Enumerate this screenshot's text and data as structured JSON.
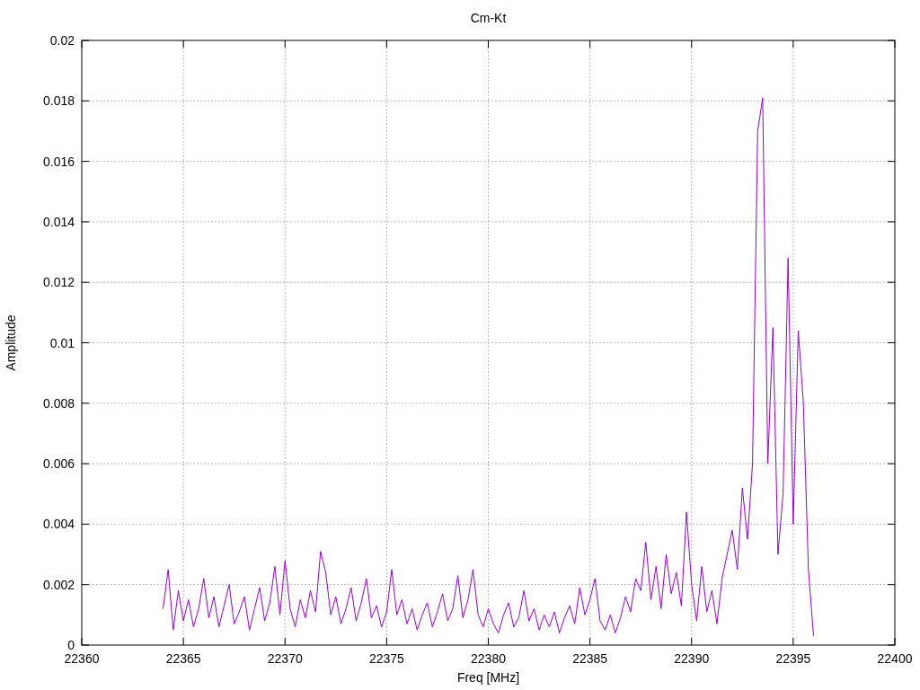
{
  "chart_data": {
    "type": "line",
    "grid": true,
    "title": "Cm-Kt",
    "xlabel": "Freq [MHz]",
    "ylabel": "Amplitude",
    "xlim": [
      22360,
      22400
    ],
    "ylim": [
      0,
      0.02
    ],
    "xticks": [
      22360,
      22365,
      22370,
      22375,
      22380,
      22385,
      22390,
      22395,
      22400
    ],
    "yticks": [
      0,
      0.002,
      0.004,
      0.006,
      0.008,
      0.01,
      0.012,
      0.014,
      0.016,
      0.018,
      0.02
    ],
    "x": [
      22364,
      22364.25,
      22364.5,
      22364.75,
      22365,
      22365.25,
      22365.5,
      22365.75,
      22366,
      22366.25,
      22366.5,
      22366.75,
      22367,
      22367.25,
      22367.5,
      22367.75,
      22368,
      22368.25,
      22368.5,
      22368.75,
      22369,
      22369.25,
      22369.5,
      22369.75,
      22370,
      22370.25,
      22370.5,
      22370.75,
      22371,
      22371.25,
      22371.5,
      22371.75,
      22372,
      22372.25,
      22372.5,
      22372.75,
      22373,
      22373.25,
      22373.5,
      22373.75,
      22374,
      22374.25,
      22374.5,
      22374.75,
      22375,
      22375.25,
      22375.5,
      22375.75,
      22376,
      22376.25,
      22376.5,
      22376.75,
      22377,
      22377.25,
      22377.5,
      22377.75,
      22378,
      22378.25,
      22378.5,
      22378.75,
      22379,
      22379.25,
      22379.5,
      22379.75,
      22380,
      22380.25,
      22380.5,
      22380.75,
      22381,
      22381.25,
      22381.5,
      22381.75,
      22382,
      22382.25,
      22382.5,
      22382.75,
      22383,
      22383.25,
      22383.5,
      22383.75,
      22384,
      22384.25,
      22384.5,
      22384.75,
      22385,
      22385.25,
      22385.5,
      22385.75,
      22386,
      22386.25,
      22386.5,
      22386.75,
      22387,
      22387.25,
      22387.5,
      22387.75,
      22388,
      22388.25,
      22388.5,
      22388.75,
      22389,
      22389.25,
      22389.5,
      22389.75,
      22390,
      22390.25,
      22390.5,
      22390.75,
      22391,
      22391.25,
      22391.5,
      22391.75,
      22392,
      22392.25,
      22392.5,
      22392.75,
      22393,
      22393.25,
      22393.5,
      22393.75,
      22394,
      22394.25,
      22394.5,
      22394.75,
      22395,
      22395.25,
      22395.5,
      22395.75,
      22396
    ],
    "series": [
      {
        "color": "#9400d3",
        "values": [
          0.0012,
          0.0025,
          0.0005,
          0.0018,
          0.0008,
          0.0015,
          0.0006,
          0.0012,
          0.0022,
          0.0009,
          0.0016,
          0.0006,
          0.0013,
          0.002,
          0.0007,
          0.0011,
          0.0016,
          0.0005,
          0.0012,
          0.0019,
          0.0008,
          0.0014,
          0.0026,
          0.001,
          0.0028,
          0.0012,
          0.0006,
          0.0015,
          0.0009,
          0.0018,
          0.0011,
          0.0031,
          0.0024,
          0.001,
          0.0016,
          0.0007,
          0.0012,
          0.0019,
          0.0008,
          0.0014,
          0.0022,
          0.0009,
          0.0013,
          0.0006,
          0.0011,
          0.0025,
          0.001,
          0.0015,
          0.0007,
          0.0012,
          0.0005,
          0.001,
          0.0014,
          0.0006,
          0.0011,
          0.0017,
          0.0008,
          0.0012,
          0.0023,
          0.0009,
          0.0015,
          0.0025,
          0.001,
          0.0006,
          0.0012,
          0.0007,
          0.0004,
          0.001,
          0.0014,
          0.0006,
          0.0009,
          0.0018,
          0.0008,
          0.0012,
          0.0005,
          0.001,
          0.0006,
          0.0011,
          0.0004,
          0.0009,
          0.0013,
          0.0007,
          0.0019,
          0.001,
          0.0015,
          0.0022,
          0.0008,
          0.0005,
          0.001,
          0.0004,
          0.0009,
          0.0016,
          0.0011,
          0.0022,
          0.0018,
          0.0034,
          0.0015,
          0.0026,
          0.0012,
          0.003,
          0.0017,
          0.0024,
          0.0013,
          0.0044,
          0.002,
          0.0008,
          0.0026,
          0.0011,
          0.0018,
          0.0007,
          0.0022,
          0.003,
          0.0038,
          0.0025,
          0.0052,
          0.0035,
          0.006,
          0.017,
          0.0181,
          0.006,
          0.0105,
          0.003,
          0.005,
          0.0128,
          0.004,
          0.0104,
          0.008,
          0.0025,
          0.0003
        ]
      }
    ]
  }
}
